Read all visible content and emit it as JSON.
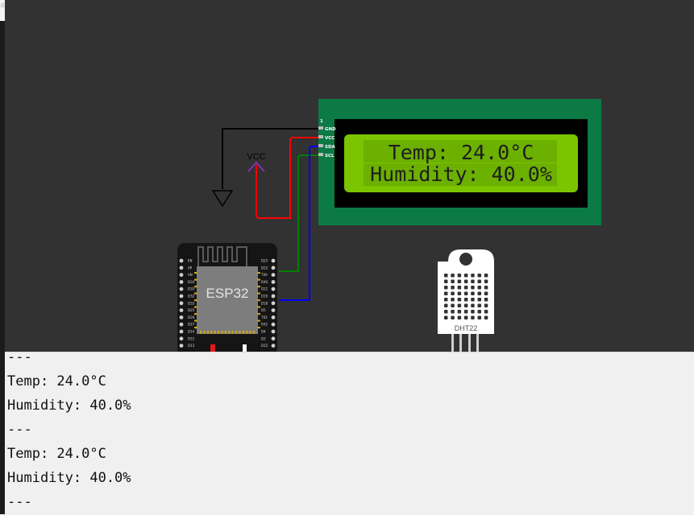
{
  "canvas": {
    "background": "#323232",
    "vcc_label": "VCC",
    "lcd": {
      "line1": "Temp: 24.0°C",
      "line2": "Humidity: 40.0%",
      "pin1_label": "1",
      "pin_labels": [
        "GND",
        "VCC",
        "SDA",
        "SCL"
      ],
      "board_color": "#0b7a45",
      "screen_color": "#7bc400"
    },
    "esp32": {
      "chip_label": "ESP32",
      "left_pins": [
        "EN",
        "VP",
        "VN",
        "D34",
        "D35",
        "D32",
        "D33",
        "D25",
        "D26",
        "D27",
        "D14",
        "D12",
        "D13"
      ],
      "right_pins": [
        "D23",
        "D22",
        "TX0",
        "RX0",
        "D21",
        "D19",
        "D18",
        "D5",
        "TX2",
        "RX2",
        "D4",
        "D2",
        "D15"
      ]
    },
    "sensor": {
      "label": "DHT22"
    },
    "wire_colors": {
      "gnd": "#000000",
      "vcc": "#ff0000",
      "sda": "#0000ff",
      "scl": "#008000",
      "power_symbol": "#9b30d0"
    }
  },
  "console": {
    "lines": [
      "---",
      "Temp: 24.0°C",
      "Humidity: 40.0%",
      "---",
      "Temp: 24.0°C",
      "Humidity: 40.0%",
      "---"
    ]
  }
}
